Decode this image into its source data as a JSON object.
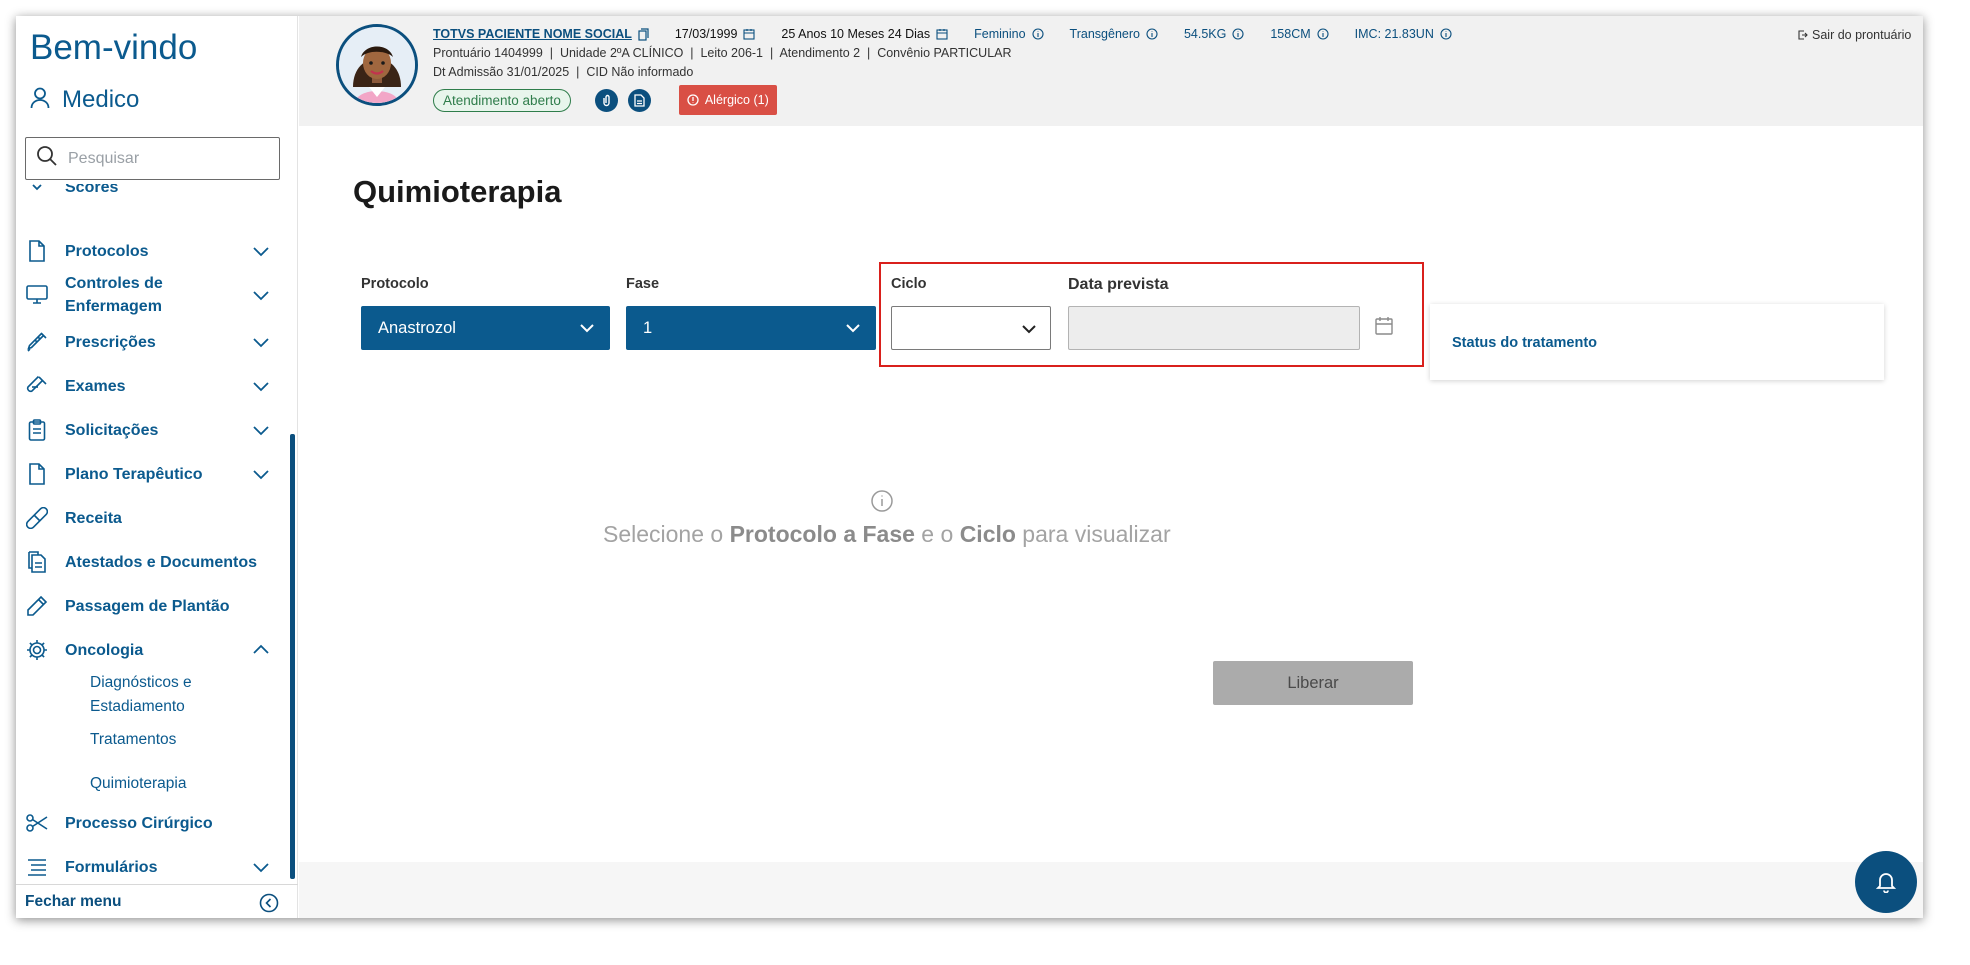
{
  "sidebar": {
    "welcome": "Bem-vindo",
    "user": "Medico",
    "search_placeholder": "Pesquisar",
    "menu": {
      "scores": "Scores",
      "protocolos": "Protocolos",
      "controles_line1": "Controles de",
      "controles_line2": "Enfermagem",
      "prescricoes": "Prescrições",
      "exames": "Exames",
      "solicitacoes": "Solicitações",
      "plano": "Plano Terapêutico",
      "receita": "Receita",
      "atestados": "Atestados e Documentos",
      "passagem": "Passagem de Plantão",
      "oncologia": "Oncologia",
      "diag_line1": "Diagnósticos e",
      "diag_line2": "Estadiamento",
      "tratamentos": "Tratamentos",
      "quimioterapia": "Quimioterapia",
      "processo": "Processo Cirúrgico",
      "formularios": "Formulários"
    },
    "close_menu": "Fechar menu"
  },
  "header": {
    "patient_name": "TOTVS PACIENTE NOME SOCIAL",
    "birth_date": "17/03/1999",
    "age": "25 Anos 10 Meses 24 Dias",
    "sex": "Feminino",
    "gender": "Transgênero",
    "weight": "54.5KG",
    "height": "158CM",
    "imc": "IMC: 21.83UN",
    "line2": "Prontuário 1404999  |  Unidade 2ºA CLÍNICO  |  Leito 206-1  |  Atendimento 2  |  Convênio PARTICULAR",
    "line3": "Dt Admissão 31/01/2025  |  CID Não informado",
    "status": "Atendimento aberto",
    "allergy": "Alérgico (1)",
    "leave": "Sair do prontuário"
  },
  "main": {
    "title": "Quimioterapia",
    "protocolo_label": "Protocolo",
    "protocolo_value": "Anastrozol",
    "fase_label": "Fase",
    "fase_value": "1",
    "ciclo_label": "Ciclo",
    "data_label": "Data prevista",
    "status_label": "Status do tratamento",
    "empty_pre": "Selecione o ",
    "empty_b1": "Protocolo a Fase",
    "empty_mid": " e o ",
    "empty_b2": "Ciclo",
    "empty_post": " para visualizar",
    "release": "Liberar"
  },
  "colors": {
    "primary": "#0b5a8e",
    "danger": "#d94f45",
    "success": "#2f7d4b",
    "highlight": "#d9201c"
  }
}
